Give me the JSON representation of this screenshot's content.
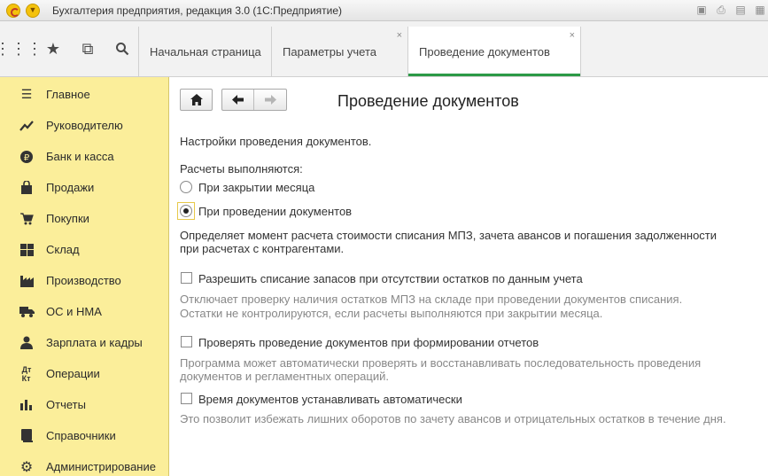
{
  "window": {
    "title": "Бухгалтерия предприятия, редакция 3.0  (1С:Предприятие)"
  },
  "tabs": [
    {
      "label": "Начальная страница"
    },
    {
      "label": "Параметры учета",
      "close": "×"
    },
    {
      "label": "Проведение документов",
      "close": "×"
    }
  ],
  "sidebar": {
    "items": [
      {
        "label": "Главное",
        "icon": "menu-lines-icon"
      },
      {
        "label": "Руководителю",
        "icon": "trend-up-icon"
      },
      {
        "label": "Банк и касса",
        "icon": "ruble-coin-icon"
      },
      {
        "label": "Продажи",
        "icon": "shopping-bag-icon"
      },
      {
        "label": "Покупки",
        "icon": "cart-icon"
      },
      {
        "label": "Склад",
        "icon": "warehouse-grid-icon"
      },
      {
        "label": "Производство",
        "icon": "factory-icon"
      },
      {
        "label": "ОС и НМА",
        "icon": "truck-icon"
      },
      {
        "label": "Зарплата и кадры",
        "icon": "person-icon"
      },
      {
        "label": "Операции",
        "icon": "debit-credit-icon"
      },
      {
        "label": "Отчеты",
        "icon": "bar-chart-icon"
      },
      {
        "label": "Справочники",
        "icon": "book-icon"
      },
      {
        "label": "Администрирование",
        "icon": "gear-icon"
      }
    ]
  },
  "main": {
    "title": "Проведение документов",
    "intro": "Настройки проведения документов.",
    "calc_label": "Расчеты выполняются:",
    "radio_month_close": "При закрытии месяца",
    "radio_on_posting": "При проведении документов",
    "radio_selected": "on_posting",
    "radio_description_1": "Определяет момент расчета стоимости списания МПЗ, зачета авансов и погашения задолженности",
    "radio_description_2": "при расчетах с контрагентами.",
    "checkbox_1_label": "Разрешить списание запасов при отсутствии остатков по данным учета",
    "checkbox_1_checked": false,
    "checkbox_1_hint_1": "Отключает проверку наличия остатков МПЗ на складе при проведении документов списания.",
    "checkbox_1_hint_2": "Остатки не контролируются, если расчеты выполняются при закрытии месяца.",
    "checkbox_2_label": "Проверять проведение документов при формировании отчетов",
    "checkbox_2_checked": false,
    "checkbox_2_hint_1": "Программа может автоматически проверять и восстанавливать последовательность проведения",
    "checkbox_2_hint_2": "документов и регламентных операций.",
    "checkbox_3_label": "Время документов устанавливать автоматически",
    "checkbox_3_checked": false,
    "checkbox_3_hint": "Это позволит избежать лишних оборотов по зачету авансов и отрицательных остатков в течение дня."
  },
  "colors": {
    "sidebar_bg": "#fbee9a",
    "active_tab_underline": "#2c9a46",
    "hint_text": "#888888"
  }
}
